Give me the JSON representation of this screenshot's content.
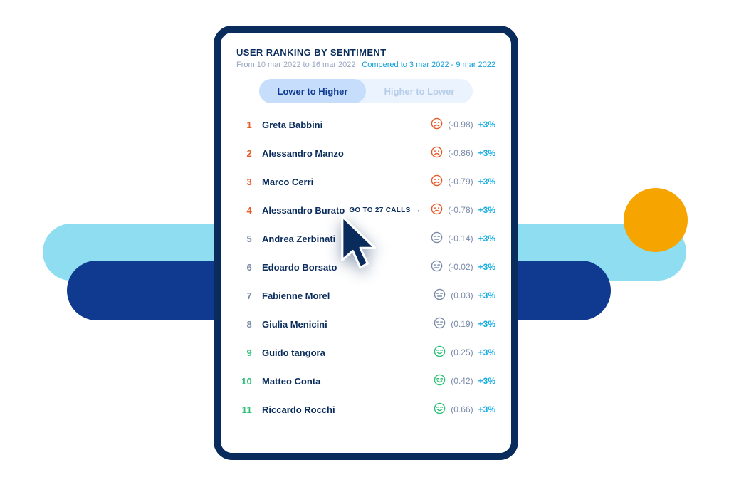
{
  "header": {
    "title": "USER RANKING BY SENTIMENT",
    "date_range": "From 10 mar 2022 to 16 mar 2022",
    "comparison": "Compered to 3 mar 2022 - 9 mar 2022"
  },
  "tabs": {
    "lower_to_higher": "Lower to Higher",
    "higher_to_lower": "Higher to Lower"
  },
  "call_link": {
    "prefix": "GO TO",
    "count": "27",
    "suffix": "CALLS"
  },
  "rows": [
    {
      "rank": "1",
      "name": "Greta Babbini",
      "sentiment": "sad",
      "score": "(-0.98)",
      "delta": "+3%",
      "rank_color": "red"
    },
    {
      "rank": "2",
      "name": "Alessandro Manzo",
      "sentiment": "sad",
      "score": "(-0.86)",
      "delta": "+3%",
      "rank_color": "red"
    },
    {
      "rank": "3",
      "name": "Marco Cerri",
      "sentiment": "sad",
      "score": "(-0.79)",
      "delta": "+3%",
      "rank_color": "red"
    },
    {
      "rank": "4",
      "name": "Alessandro Burato",
      "sentiment": "sad",
      "score": "(-0.78)",
      "delta": "+3%",
      "rank_color": "red",
      "show_link": true
    },
    {
      "rank": "5",
      "name": "Andrea Zerbinati",
      "sentiment": "neutral",
      "score": "(-0.14)",
      "delta": "+3%",
      "rank_color": "grey"
    },
    {
      "rank": "6",
      "name": "Edoardo Borsato",
      "sentiment": "neutral",
      "score": "(-0.02)",
      "delta": "+3%",
      "rank_color": "grey"
    },
    {
      "rank": "7",
      "name": "Fabienne Morel",
      "sentiment": "neutral",
      "score": "(0.03)",
      "delta": "+3%",
      "rank_color": "grey"
    },
    {
      "rank": "8",
      "name": "Giulia Menicini",
      "sentiment": "neutral",
      "score": "(0.19)",
      "delta": "+3%",
      "rank_color": "grey"
    },
    {
      "rank": "9",
      "name": "Guido tangora",
      "sentiment": "happy",
      "score": "(0.25)",
      "delta": "+3%",
      "rank_color": "green"
    },
    {
      "rank": "10",
      "name": "Matteo Conta",
      "sentiment": "happy",
      "score": "(0.42)",
      "delta": "+3%",
      "rank_color": "green"
    },
    {
      "rank": "11",
      "name": "Riccardo Rocchi",
      "sentiment": "happy",
      "score": "(0.66)",
      "delta": "+3%",
      "rank_color": "green"
    }
  ],
  "colors": {
    "sad": "#E65A28",
    "neutral": "#7A8AA8",
    "happy": "#2FC178"
  }
}
